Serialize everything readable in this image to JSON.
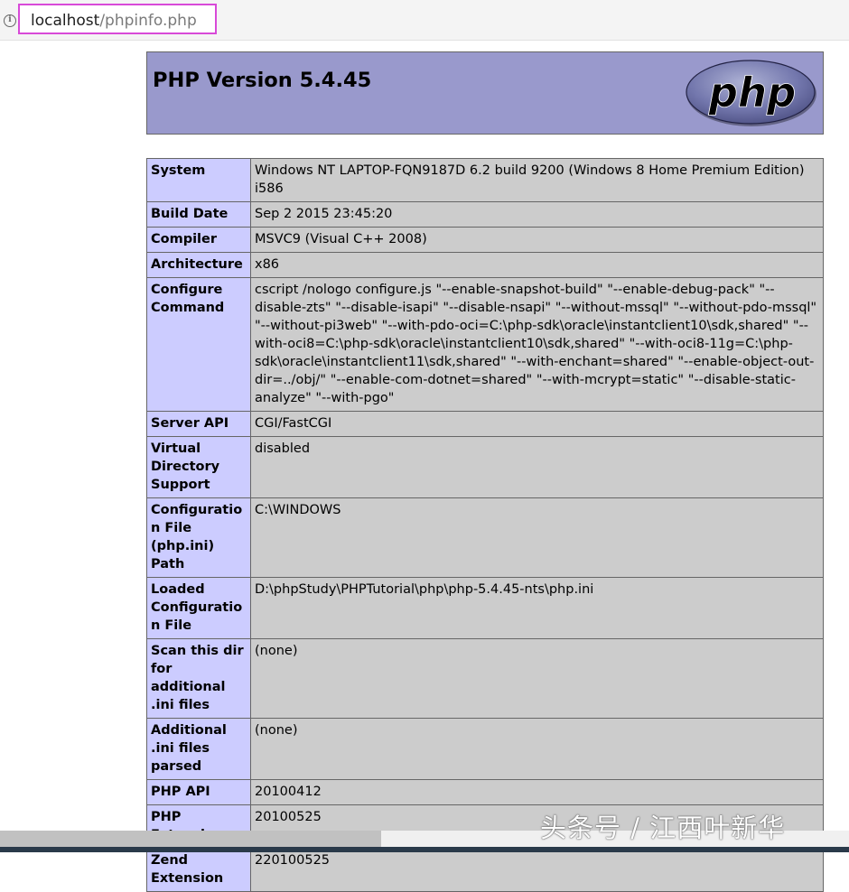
{
  "address_bar": {
    "host": "localhost",
    "path": "/phpinfo.php"
  },
  "header": {
    "title": "PHP Version 5.4.45",
    "logo_text": "php"
  },
  "info_rows": [
    {
      "key": "System",
      "value": "Windows NT LAPTOP-FQN9187D 6.2 build 9200 (Windows 8 Home Premium Edition) i586"
    },
    {
      "key": "Build Date",
      "value": "Sep 2 2015 23:45:20"
    },
    {
      "key": "Compiler",
      "value": "MSVC9 (Visual C++ 2008)"
    },
    {
      "key": "Architecture",
      "value": "x86"
    },
    {
      "key": "Configure Command",
      "value": "cscript /nologo configure.js \"--enable-snapshot-build\" \"--enable-debug-pack\" \"--disable-zts\" \"--disable-isapi\" \"--disable-nsapi\" \"--without-mssql\" \"--without-pdo-mssql\" \"--without-pi3web\" \"--with-pdo-oci=C:\\php-sdk\\oracle\\instantclient10\\sdk,shared\" \"--with-oci8=C:\\php-sdk\\oracle\\instantclient10\\sdk,shared\" \"--with-oci8-11g=C:\\php-sdk\\oracle\\instantclient11\\sdk,shared\" \"--with-enchant=shared\" \"--enable-object-out-dir=../obj/\" \"--enable-com-dotnet=shared\" \"--with-mcrypt=static\" \"--disable-static-analyze\" \"--with-pgo\""
    },
    {
      "key": "Server API",
      "value": "CGI/FastCGI"
    },
    {
      "key": "Virtual Directory Support",
      "value": "disabled"
    },
    {
      "key": "Configuration File (php.ini) Path",
      "value": "C:\\WINDOWS"
    },
    {
      "key": "Loaded Configuration File",
      "value": "D:\\phpStudy\\PHPTutorial\\php\\php-5.4.45-nts\\php.ini"
    },
    {
      "key": "Scan this dir for additional .ini files",
      "value": "(none)"
    },
    {
      "key": "Additional .ini files parsed",
      "value": "(none)"
    },
    {
      "key": "PHP API",
      "value": "20100412"
    },
    {
      "key": "PHP Extension",
      "value": "20100525"
    },
    {
      "key": "Zend Extension",
      "value": "220100525"
    }
  ],
  "watermark": "头条号 / 江西叶新华"
}
